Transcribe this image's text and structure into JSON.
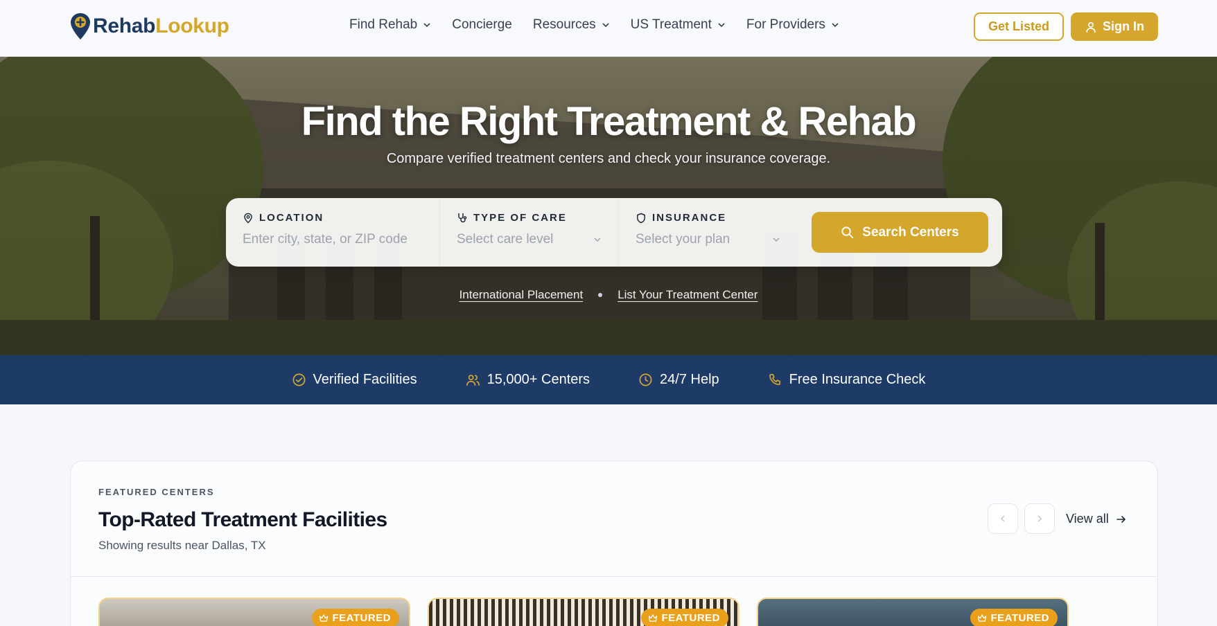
{
  "brand": {
    "part1": "Rehab",
    "part2": "Lookup"
  },
  "nav": {
    "items": [
      {
        "label": "Find Rehab",
        "dropdown": true
      },
      {
        "label": "Concierge",
        "dropdown": false
      },
      {
        "label": "Resources",
        "dropdown": true
      },
      {
        "label": "US Treatment",
        "dropdown": true
      },
      {
        "label": "For Providers",
        "dropdown": true
      }
    ],
    "get_listed": "Get Listed",
    "sign_in": "Sign In"
  },
  "hero": {
    "title": "Find the Right Treatment & Rehab",
    "subtitle": "Compare verified treatment centers and check your insurance coverage.",
    "search": {
      "location_label": "LOCATION",
      "location_placeholder": "Enter city, state, or ZIP code",
      "care_label": "TYPE OF CARE",
      "care_value": "Select care level",
      "insurance_label": "INSURANCE",
      "insurance_value": "Select your plan",
      "button": "Search Centers"
    },
    "links": [
      "International Placement",
      "List Your Treatment Center"
    ]
  },
  "trust": [
    {
      "icon": "check-circle-icon",
      "label": "Verified Facilities"
    },
    {
      "icon": "users-icon",
      "label": "15,000+ Centers"
    },
    {
      "icon": "clock-icon",
      "label": "24/7 Help"
    },
    {
      "icon": "phone-icon",
      "label": "Free Insurance Check"
    }
  ],
  "featured": {
    "eyebrow": "FEATURED CENTERS",
    "title": "Top-Rated Treatment Facilities",
    "subtitle": "Showing results near Dallas, TX",
    "view_all": "View all",
    "badge": "FEATURED"
  },
  "colors": {
    "accent": "#d4a72c",
    "navy": "#1e3a66",
    "brand_dark": "#1e3a5f"
  }
}
